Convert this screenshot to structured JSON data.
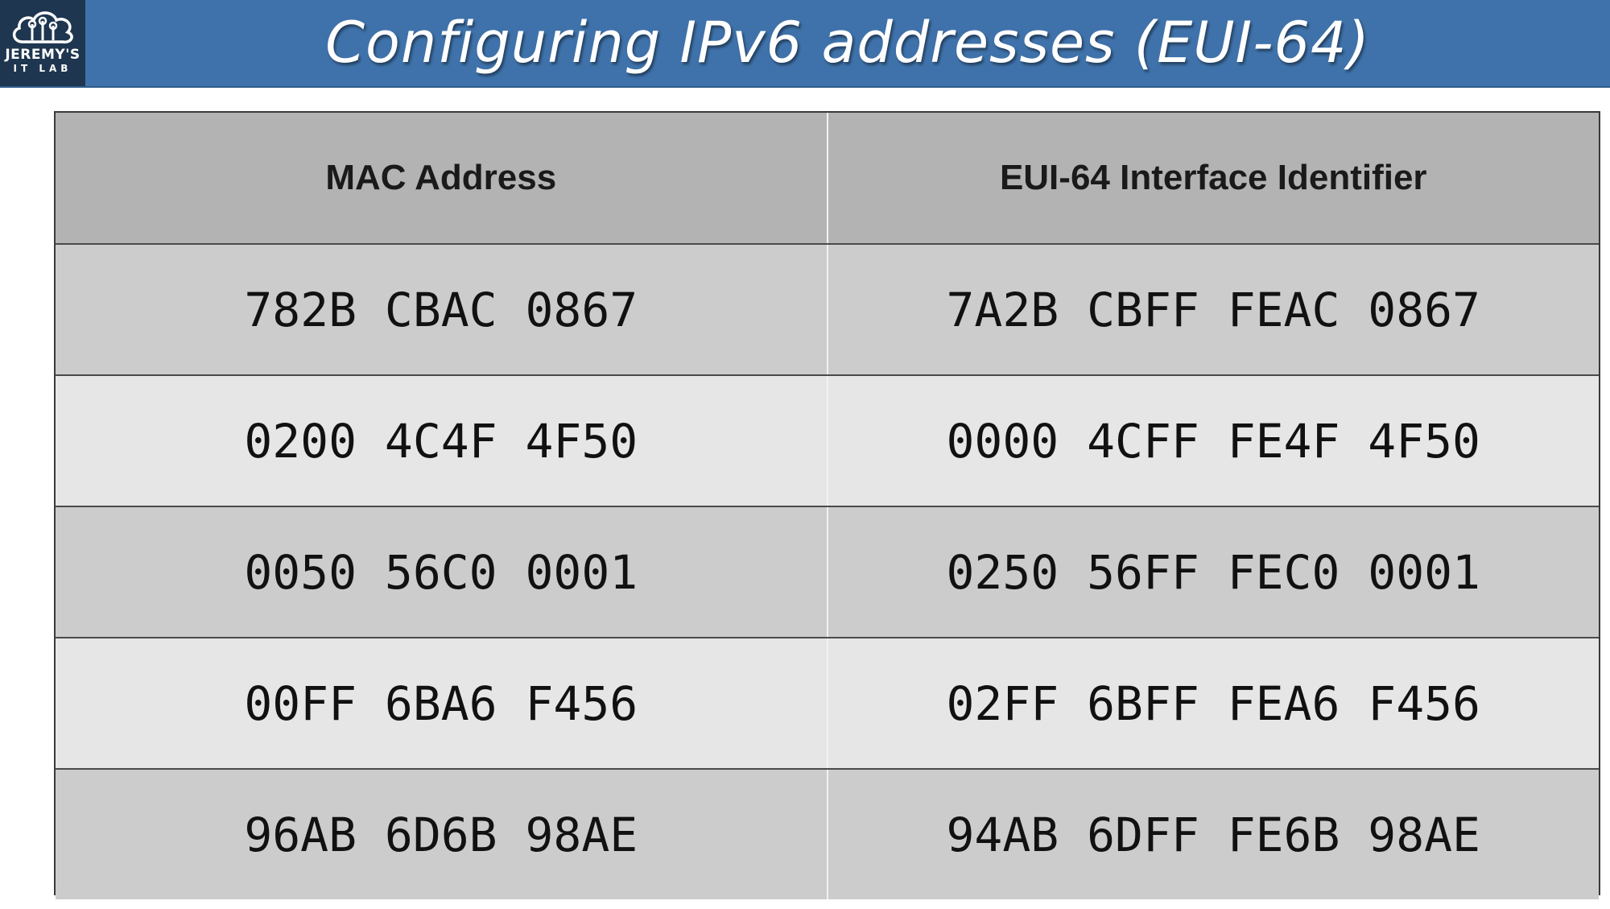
{
  "header": {
    "title": "Configuring IPv6 addresses (EUI-64)",
    "logo_line1": "JEREMY'S",
    "logo_line2": "IT LAB",
    "background_color": "#3f72aa"
  },
  "table": {
    "columns": [
      "MAC Address",
      "EUI-64 Interface Identifier"
    ],
    "rows": [
      {
        "mac": "782B CBAC 0867",
        "eui64": "7A2B CBFF FEAC 0867"
      },
      {
        "mac": "0200 4C4F 4F50",
        "eui64": "0000 4CFF FE4F 4F50"
      },
      {
        "mac": "0050 56C0 0001",
        "eui64": "0250 56FF FEC0 0001"
      },
      {
        "mac": "00FF 6BA6 F456",
        "eui64": "02FF 6BFF FEA6 F456"
      },
      {
        "mac": "96AB 6D6B 98AE",
        "eui64": "94AB 6DFF FE6B 98AE"
      }
    ]
  }
}
